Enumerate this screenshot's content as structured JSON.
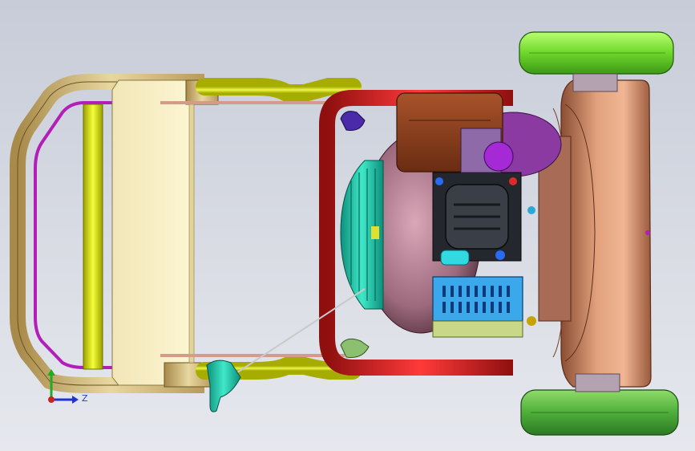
{
  "viewport": {
    "background_top": "#c7ccd8",
    "background_bottom": "#e6e8ee"
  },
  "model": {
    "description_icon": "lawn-mower-assembly-icon"
  },
  "triad": {
    "z_label": "Z",
    "y_color": "#22aa22",
    "z_color": "#2233cc",
    "x_color": "#cc2222"
  }
}
